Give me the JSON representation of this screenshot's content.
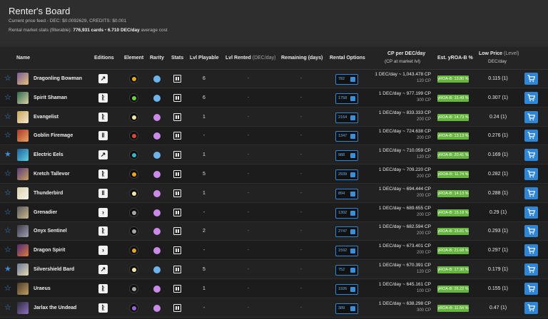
{
  "header": {
    "title": "Renter's Board",
    "price_feed": "Current price feed - DEC: $0.0092629, CREDITS: $0.001",
    "market_stats_prefix": "Rental market stats (filterable):",
    "cards": "776,931 cards",
    "bullet": "•",
    "avg_cost": "6.710 DEC/day",
    "avg_suffix": "average cost"
  },
  "columns": {
    "name": "Name",
    "editions": "Editions",
    "element": "Element",
    "rarity": "Rarity",
    "stats": "Stats",
    "lvl_playable": "Lvl Playable",
    "lvl_rented": "Lvl Rented",
    "lvl_rented_unit": "(DEC/day)",
    "remaining": "Remaining (days)",
    "rental_options": "Rental Options",
    "cp_per_dec": "CP per DEC/day",
    "cp_sub": "(CP at market lvl)",
    "yroa": "Est. yROA-B %",
    "low_price": "Low Price",
    "low_price_unit": "(Level)",
    "low_price_sub": "DEC/day"
  },
  "colors": {
    "accent": "#2f86d6",
    "yroa_badge": "#66b53f",
    "rarity_common": "#6fb3ea",
    "rarity_rare": "#c98ae8",
    "element_fire": "#e0453a",
    "element_water": "#35b7c9",
    "element_earth": "#6ad13a",
    "element_life": "#f1e5a8",
    "element_death": "#9d62d9",
    "element_dragon": "#e6a61d",
    "element_neutral": "#a6a6a6"
  },
  "rows": [
    {
      "name": "Dragonling Bowman",
      "edition": "reward-edition-icon",
      "element": "dragon",
      "rarity": "common",
      "lvl_playable": "6",
      "lvl_rented": "-",
      "remaining": "-",
      "rental_count": "782",
      "cp_main": "1 DEC/day ~ 1,043.478 CP",
      "cp_sub": "120 CP",
      "yroa": "yROA-B: 13.80 %",
      "low_price": "0.115 (1)",
      "starred": false
    },
    {
      "name": "Spirit Shaman",
      "edition": "chaos-edition-icon",
      "element": "earth",
      "rarity": "common",
      "lvl_playable": "6",
      "lvl_rented": "-",
      "remaining": "-",
      "rental_count": "1758",
      "cp_main": "1 DEC/day ~ 977.199 CP",
      "cp_sub": "300 CP",
      "yroa": "yROA-B: 15.49 %",
      "low_price": "0.307 (1)",
      "starred": false
    },
    {
      "name": "Evangelist",
      "edition": "chaos-edition-icon",
      "element": "life",
      "rarity": "rare",
      "lvl_playable": "1",
      "lvl_rented": "-",
      "remaining": "-",
      "rental_count": "2164",
      "cp_main": "1 DEC/day ~ 833.333 CP",
      "cp_sub": "200 CP",
      "yroa": "yROA-B: 14.73 %",
      "low_price": "0.24 (1)",
      "starred": false
    },
    {
      "name": "Goblin Firemage",
      "edition": "untamed-edition-icon",
      "element": "fire",
      "rarity": "rare",
      "lvl_playable": "-",
      "lvl_rented": "-",
      "remaining": "-",
      "rental_count": "1347",
      "cp_main": "1 DEC/day ~ 724.638 CP",
      "cp_sub": "200 CP",
      "yroa": "yROA-B: 13.13 %",
      "low_price": "0.276 (1)",
      "starred": false
    },
    {
      "name": "Electric Eels",
      "edition": "reward-edition-icon",
      "element": "water",
      "rarity": "common",
      "lvl_playable": "1",
      "lvl_rented": "-",
      "remaining": "-",
      "rental_count": "988",
      "cp_main": "1 DEC/day ~ 710.059 CP",
      "cp_sub": "120 CP",
      "yroa": "yROA-B: 20.41 %",
      "low_price": "0.169 (1)",
      "starred": true
    },
    {
      "name": "Kretch Tallevor",
      "edition": "chaos-edition-icon",
      "element": "dragon",
      "rarity": "rare",
      "lvl_playable": "5",
      "lvl_rented": "-",
      "remaining": "-",
      "rental_count": "2939",
      "cp_main": "1 DEC/day ~ 709.220 CP",
      "cp_sub": "200 CP",
      "yroa": "yROA-B: 11.74 %",
      "low_price": "0.282 (1)",
      "starred": false
    },
    {
      "name": "Thunderbird",
      "edition": "untamed-edition-icon",
      "element": "life",
      "rarity": "rare",
      "lvl_playable": "1",
      "lvl_rented": "-",
      "remaining": "-",
      "rental_count": "894",
      "cp_main": "1 DEC/day ~ 694.444 CP",
      "cp_sub": "200 CP",
      "yroa": "yROA-B: 14.13 %",
      "low_price": "0.288 (1)",
      "starred": false
    },
    {
      "name": "Grenadier",
      "edition": "rebellion-edition-icon",
      "element": "neutral",
      "rarity": "rare",
      "lvl_playable": "-",
      "lvl_rented": "-",
      "remaining": "-",
      "rental_count": "1302",
      "cp_main": "1 DEC/day ~ 689.655 CP",
      "cp_sub": "200 CP",
      "yroa": "yROA-B: 15.18 %",
      "low_price": "0.29 (1)",
      "starred": false
    },
    {
      "name": "Onyx Sentinel",
      "edition": "chaos-edition-icon",
      "element": "neutral",
      "rarity": "rare",
      "lvl_playable": "2",
      "lvl_rented": "-",
      "remaining": "-",
      "rental_count": "2747",
      "cp_main": "1 DEC/day ~ 682.594 CP",
      "cp_sub": "200 CP",
      "yroa": "yROA-B: 15.81 %",
      "low_price": "0.293 (1)",
      "starred": false
    },
    {
      "name": "Dragon Spirit",
      "edition": "rebellion-edition-icon",
      "element": "dragon",
      "rarity": "rare",
      "lvl_playable": "-",
      "lvl_rented": "-",
      "remaining": "-",
      "rental_count": "1592",
      "cp_main": "1 DEC/day ~ 673.401 CP",
      "cp_sub": "200 CP",
      "yroa": "yROA-B: 21.68 %",
      "low_price": "0.297 (1)",
      "starred": false
    },
    {
      "name": "Silvershield Bard",
      "edition": "reward-edition-icon",
      "element": "life",
      "rarity": "common",
      "lvl_playable": "5",
      "lvl_rented": "-",
      "remaining": "-",
      "rental_count": "752",
      "cp_main": "1 DEC/day ~ 670.391 CP",
      "cp_sub": "120 CP",
      "yroa": "yROA-B: 17.30 %",
      "low_price": "0.179 (1)",
      "starred": true
    },
    {
      "name": "Uraeus",
      "edition": "chaos-edition-icon",
      "element": "neutral",
      "rarity": "rare",
      "lvl_playable": "1",
      "lvl_rented": "-",
      "remaining": "-",
      "rental_count": "1926",
      "cp_main": "1 DEC/day ~ 645.161 CP",
      "cp_sub": "100 CP",
      "yroa": "yROA-B: 26.22 %",
      "low_price": "0.155 (1)",
      "starred": false
    },
    {
      "name": "Jarlax the Undead",
      "edition": "chaos-edition-icon",
      "element": "death",
      "rarity": "rare",
      "lvl_playable": "-",
      "lvl_rented": "-",
      "remaining": "-",
      "rental_count": "389",
      "cp_main": "1 DEC/day ~ 638.298 CP",
      "cp_sub": "300 CP",
      "yroa": "yROA-B: 11.64 %",
      "low_price": "0.47 (1)",
      "starred": false
    }
  ]
}
